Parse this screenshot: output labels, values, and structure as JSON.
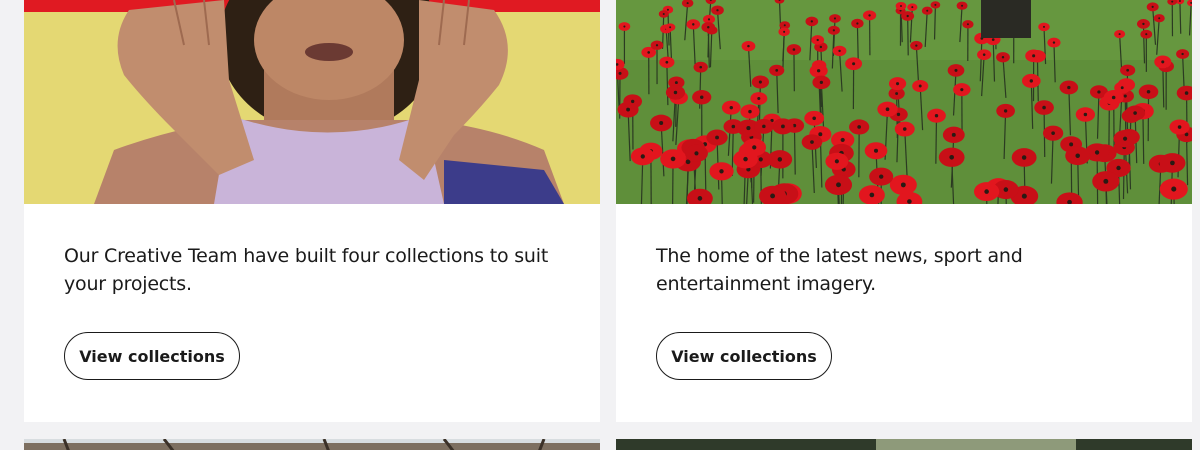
{
  "cards": [
    {
      "image_alt": "Young woman with curly hair holding a red ribbon in front of her face against a yellow background",
      "description": "Our Creative Team have built four collections to suit your projects.",
      "button_label": "View collections"
    },
    {
      "image_alt": "Field of red ceramic poppies on green grass",
      "description": "The home of the latest news, sport and entertainment imagery.",
      "button_label": "View collections"
    }
  ],
  "colors": {
    "page_background": "#f2f2f4",
    "card_background": "#ffffff",
    "text": "#1a1a1a",
    "accent_red": "#e1161c"
  }
}
